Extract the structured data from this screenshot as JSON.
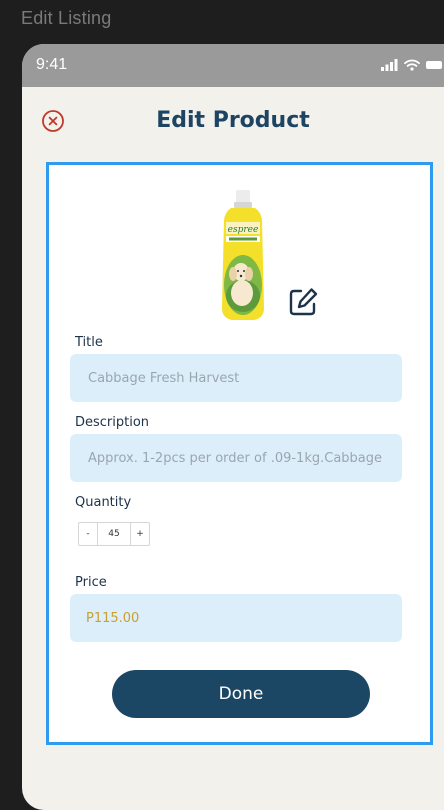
{
  "window": {
    "title": "Edit Listing"
  },
  "status_bar": {
    "time": "9:41"
  },
  "header": {
    "title": "Edit Product",
    "close_icon": "close-circle-icon"
  },
  "product": {
    "image": "shampoo-bottle-image",
    "edit_icon": "edit-pencil-icon"
  },
  "form": {
    "title_label": "Title",
    "title_value": "Cabbage Fresh Harvest",
    "description_label": "Description",
    "description_value": "Approx. 1-2pcs per order of .09-1kg.Cabbage",
    "quantity_label": "Quantity",
    "quantity_minus": "-",
    "quantity_value": "45",
    "quantity_plus": "+",
    "price_label": "Price",
    "price_value": "P115.00"
  },
  "actions": {
    "done_label": "Done"
  },
  "colors": {
    "accent": "#1c4764",
    "title": "#1d4563",
    "focus_border": "#2f9bf0",
    "field_bg": "#ddeefb",
    "price_text": "#c8a030",
    "close_icon": "#c0392b"
  }
}
